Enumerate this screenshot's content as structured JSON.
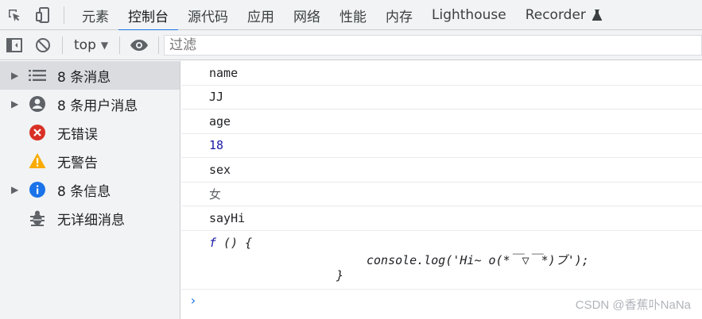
{
  "tabs": [
    {
      "label": "元素"
    },
    {
      "label": "控制台"
    },
    {
      "label": "源代码"
    },
    {
      "label": "应用"
    },
    {
      "label": "网络"
    },
    {
      "label": "性能"
    },
    {
      "label": "内存"
    },
    {
      "label": "Lighthouse"
    },
    {
      "label": "Recorder"
    }
  ],
  "active_tab": "控制台",
  "toolbar": {
    "context": "top",
    "filter_placeholder": "过滤"
  },
  "sidebar": {
    "items": [
      {
        "label": "8 条消息",
        "icon": "list-icon",
        "expandable": true
      },
      {
        "label": "8 条用户消息",
        "icon": "user-icon",
        "expandable": true
      },
      {
        "label": "无错误",
        "icon": "error-icon",
        "expandable": false
      },
      {
        "label": "无警告",
        "icon": "warning-icon",
        "expandable": false
      },
      {
        "label": "8 条信息",
        "icon": "info-icon",
        "expandable": true
      },
      {
        "label": "无详细消息",
        "icon": "bug-icon",
        "expandable": false
      }
    ]
  },
  "console": {
    "lines": [
      "name",
      "JJ",
      "age",
      "18",
      "sex",
      "女",
      "sayHi"
    ],
    "function_keyword": "f",
    "function_head": " () {",
    "function_body": "console.log('Hi~ o(*￣▽￣*)ブ');",
    "function_close": "}",
    "prompt": "›"
  },
  "watermark": "CSDN @香蕉卟NaNa",
  "colors": {
    "accent": "#1a73e8",
    "number": "#1a1aa6",
    "error": "#d93025",
    "warning": "#f9ab00",
    "info": "#1a73e8"
  }
}
